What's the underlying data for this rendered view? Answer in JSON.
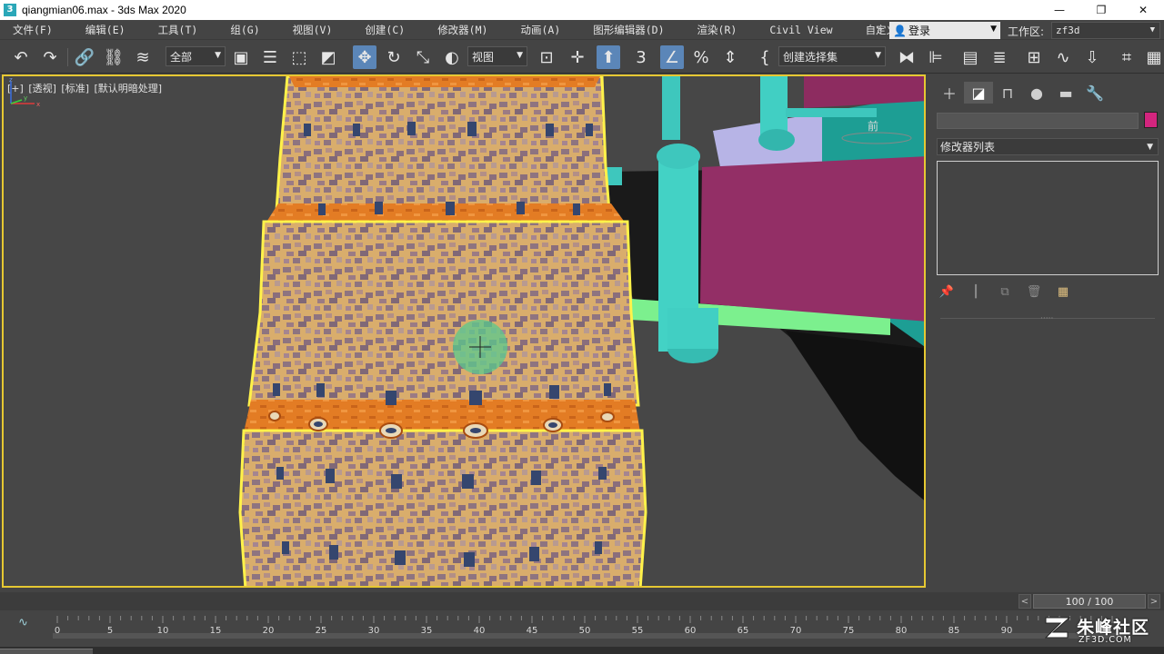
{
  "window": {
    "title": "qiangmian06.max - 3ds Max 2020",
    "minimize": "—",
    "maximize": "❐",
    "close": "✕"
  },
  "menu": {
    "items": [
      "文件(F)",
      "编辑(E)",
      "工具(T)",
      "组(G)",
      "视图(V)",
      "创建(C)",
      "修改器(M)",
      "动画(A)",
      "图形编辑器(D)",
      "渲染(R)",
      "Civil View",
      "自定义(U)"
    ],
    "more": "»",
    "login": "登录",
    "workspace_label": "工作区:",
    "workspace_value": "zf3d"
  },
  "toolbar": {
    "selection_filter": "全部",
    "reference_coord": "视图",
    "named_selection": "创建选择集",
    "snap_label": "3"
  },
  "viewport": {
    "labels": [
      "[+]",
      "[透视]",
      "[标准]",
      "[默认明暗处理]"
    ],
    "viewcube_face": "前",
    "axis_x": "x",
    "axis_y": "y",
    "axis_z": "z"
  },
  "command_panel": {
    "object_color": "#d3257e",
    "modifier_list": "修改器列表"
  },
  "timeline": {
    "counter": "100 / 100",
    "ticks": [
      "0",
      "5",
      "10",
      "15",
      "20",
      "25",
      "30",
      "35",
      "40",
      "45",
      "50",
      "55",
      "60",
      "65",
      "70",
      "75",
      "80",
      "85",
      "90"
    ]
  },
  "watermark": {
    "text": "朱峰社区",
    "sub": "ZF3D.COM"
  }
}
